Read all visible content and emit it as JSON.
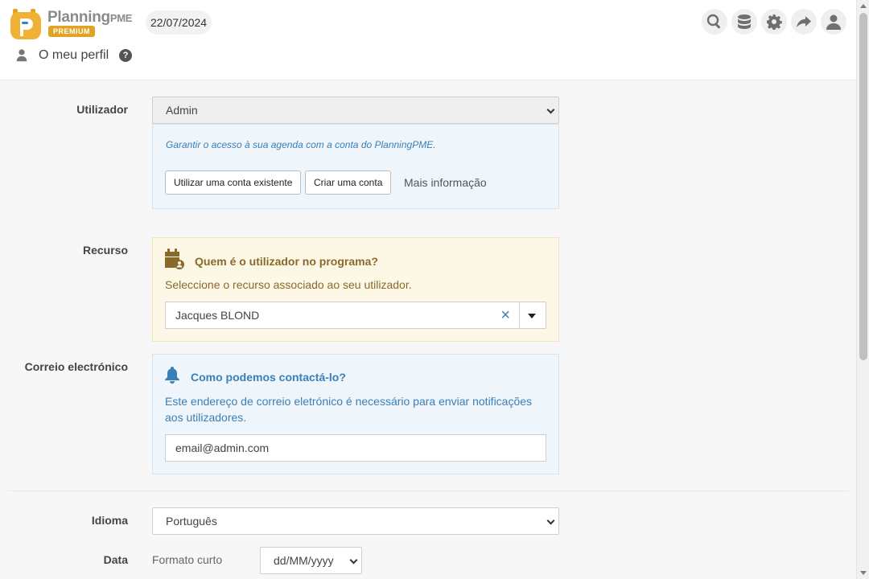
{
  "header": {
    "logo": {
      "name": "Planning",
      "suffix": "PME",
      "badge": "PREMIUM"
    },
    "date": "22/07/2024",
    "icons": [
      "search-icon",
      "database-icon",
      "gear-icon",
      "share-icon",
      "user-icon"
    ]
  },
  "page": {
    "title": "O meu perfil",
    "help": "?"
  },
  "user_section": {
    "label": "Utilizador",
    "selected": "Admin",
    "note": "Garantir o acesso à sua agenda com a conta do PlanningPME.",
    "btn_existing": "Utilizar uma conta existente",
    "btn_create": "Criar uma conta",
    "more_info": "Mais informação"
  },
  "resource_section": {
    "label": "Recurso",
    "title": "Quem é o utilizador no programa?",
    "text": "Seleccione o recurso associado ao seu utilizador.",
    "value": "Jacques BLOND",
    "clear": "×",
    "color": "#8a6a2a"
  },
  "email_section": {
    "label": "Correio electrónico",
    "title": "Como podemos contactá-lo?",
    "text": "Este endereço de correio eletrónico é necessário para enviar notificações aos utilizadores.",
    "value": "email@admin.com",
    "color": "#3b7fb6"
  },
  "language_section": {
    "label": "Idioma",
    "selected": "Português"
  },
  "date_section": {
    "label": "Data",
    "sublabel": "Formato curto",
    "selected": "dd/MM/yyyy"
  }
}
